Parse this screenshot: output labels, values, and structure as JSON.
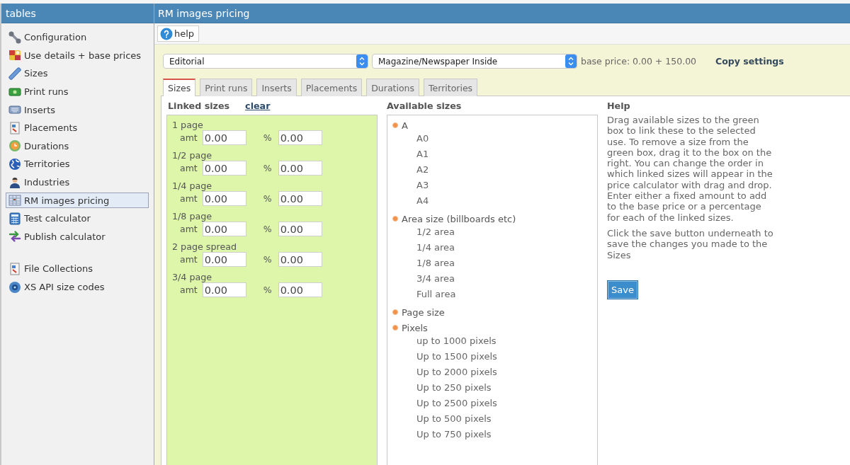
{
  "sidebar": {
    "title": "tables",
    "sections": [
      {
        "items": [
          {
            "label": "Configuration",
            "selected": false
          },
          {
            "label": "Use details + base prices",
            "selected": false
          },
          {
            "label": "Sizes",
            "selected": false
          },
          {
            "label": "Print runs",
            "selected": false
          },
          {
            "label": "Inserts",
            "selected": false
          },
          {
            "label": "Placements",
            "selected": false
          },
          {
            "label": "Durations",
            "selected": false
          },
          {
            "label": "Territories",
            "selected": false
          },
          {
            "label": "Industries",
            "selected": false
          },
          {
            "label": "RM images pricing",
            "selected": true
          },
          {
            "label": "Test calculator",
            "selected": false
          },
          {
            "label": "Publish calculator",
            "selected": false
          }
        ]
      },
      {
        "items": [
          {
            "label": "File Collections",
            "selected": false
          },
          {
            "label": "XS API size codes",
            "selected": false
          }
        ]
      }
    ]
  },
  "main": {
    "title": "RM images pricing"
  },
  "toolbar": {
    "help_button": "help"
  },
  "settings": {
    "selects": [
      {
        "value": "Editorial"
      },
      {
        "value": "Magazine/Newspaper Inside"
      }
    ],
    "base_price": "base price: 0.00 + 150.00",
    "copy_settings": "Copy settings"
  },
  "tabs": [
    {
      "label": "Sizes",
      "selected": true
    },
    {
      "label": "Print runs",
      "selected": false
    },
    {
      "label": "Inserts",
      "selected": false
    },
    {
      "label": "Placements",
      "selected": false
    },
    {
      "label": "Durations",
      "selected": false
    },
    {
      "label": "Territories",
      "selected": false
    }
  ],
  "linked_sizes": {
    "title": "Linked sizes",
    "clear_link": "clear",
    "items": [
      {
        "label": "1 page",
        "amount_label": "amt",
        "amount": "0.00",
        "percent_label": "%",
        "percent": "0.00"
      },
      {
        "label": "1/2 page",
        "amount_label": "amt",
        "amount": "0.00",
        "percent_label": "%",
        "percent": "0.00"
      },
      {
        "label": "1/4 page",
        "amount_label": "amt",
        "amount": "0.00",
        "percent_label": "%",
        "percent": "0.00"
      },
      {
        "label": "1/8 page",
        "amount_label": "amt",
        "amount": "0.00",
        "percent_label": "%",
        "percent": "0.00"
      },
      {
        "label": "2 page spread",
        "amount_label": "amt",
        "amount": "0.00",
        "percent_label": "%",
        "percent": "0.00"
      },
      {
        "label": "3/4 page",
        "amount_label": "amt",
        "amount": "0.00",
        "percent_label": "%",
        "percent": "0.00"
      }
    ]
  },
  "available_sizes": {
    "title": "Available sizes",
    "items": [
      {
        "label": "A",
        "children": [
          {
            "label": "A0"
          },
          {
            "label": "A1"
          },
          {
            "label": "A2"
          },
          {
            "label": "A3"
          },
          {
            "label": "A4"
          }
        ]
      },
      {
        "label": "Area size (billboards etc)",
        "children": [
          {
            "label": "1/2 area"
          },
          {
            "label": "1/4 area"
          },
          {
            "label": "1/8 area"
          },
          {
            "label": "3/4 area"
          },
          {
            "label": "Full area"
          }
        ]
      },
      {
        "label": "Page size"
      },
      {
        "label": "Pixels",
        "children": [
          {
            "label": "up to 1000 pixels"
          },
          {
            "label": "Up to 1500 pixels"
          },
          {
            "label": "Up to 2000 pixels"
          },
          {
            "label": "Up to 250 pixels"
          },
          {
            "label": "Up to 2500 pixels"
          },
          {
            "label": "Up to 500 pixels"
          },
          {
            "label": "Up to 750 pixels"
          }
        ]
      }
    ]
  },
  "help": {
    "title": "Help",
    "paragraphs": [
      "Drag available sizes to the green box to link these to the selected use. To remove a size from the green box, drag it to the box on the right. You can change the order in which linked sizes will appear in the price calculator with drag and drop. Enter either a fixed amount to add to the base price or a percentage for each of the linked sizes.",
      "Click the save button underneath to save the changes you made to the Sizes"
    ],
    "save_button": "Save"
  }
}
